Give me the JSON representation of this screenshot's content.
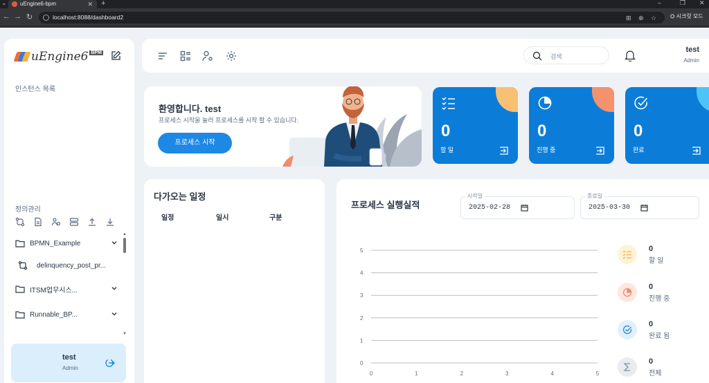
{
  "browser": {
    "tab_title": "uEngine6-bpm",
    "url": "localhost:8088/dashboard2",
    "incognito_label": "시크릿 모드"
  },
  "sidebar": {
    "logo_text": "uEngine6",
    "logo_badge": "BPM",
    "instance_list_label": "인스턴스 목록",
    "definition_label": "정의관리",
    "tree": [
      {
        "label": "BPMN_Example",
        "type": "folder"
      },
      {
        "label": "delinquency_post_pr...",
        "type": "process"
      },
      {
        "label": "ITSM업무시스...",
        "type": "folder"
      },
      {
        "label": "Runnable_BP...",
        "type": "folder"
      }
    ],
    "user": {
      "name": "test",
      "role": "Admin"
    }
  },
  "header": {
    "search_placeholder": "검색",
    "user_name": "test",
    "user_role": "Admin"
  },
  "welcome": {
    "title": "환영합니다. test",
    "subtitle": "프로세스 시작을 눌러 프로세스를 시작 할 수 있습니다.",
    "button": "프로세스 시작"
  },
  "stats": [
    {
      "value": "0",
      "label": "할 일",
      "blob_color": "#f8c072"
    },
    {
      "value": "0",
      "label": "진행 중",
      "blob_color": "#f4926d"
    },
    {
      "value": "0",
      "label": "완료",
      "blob_color": "#4fc3f7"
    }
  ],
  "schedule": {
    "title": "다가오는 일정",
    "columns": [
      "일정",
      "일시",
      "구분"
    ]
  },
  "performance": {
    "title": "프로세스 실행실적",
    "start_label": "시작일",
    "start_value": "2025-02-28",
    "end_label": "종료일",
    "end_value": "2025-03-30",
    "legend": [
      {
        "value": "0",
        "label": "할 일",
        "bg": "#fff3d6",
        "fg": "#f5b040"
      },
      {
        "value": "0",
        "label": "진행 중",
        "bg": "#fde7e0",
        "fg": "#f08c6c"
      },
      {
        "value": "0",
        "label": "완료 됨",
        "bg": "#e0f1fc",
        "fg": "#1e88e5"
      },
      {
        "value": "0",
        "label": "전체",
        "bg": "#e8ebef",
        "fg": "#7c8fac"
      }
    ]
  },
  "chart_data": {
    "type": "line",
    "x_ticks": [
      0,
      1,
      2,
      3,
      4,
      5
    ],
    "y_ticks": [
      0,
      1,
      2,
      3,
      4,
      5
    ],
    "xlim": [
      0,
      5
    ],
    "ylim": [
      0,
      5
    ],
    "series": [],
    "grid": true
  }
}
